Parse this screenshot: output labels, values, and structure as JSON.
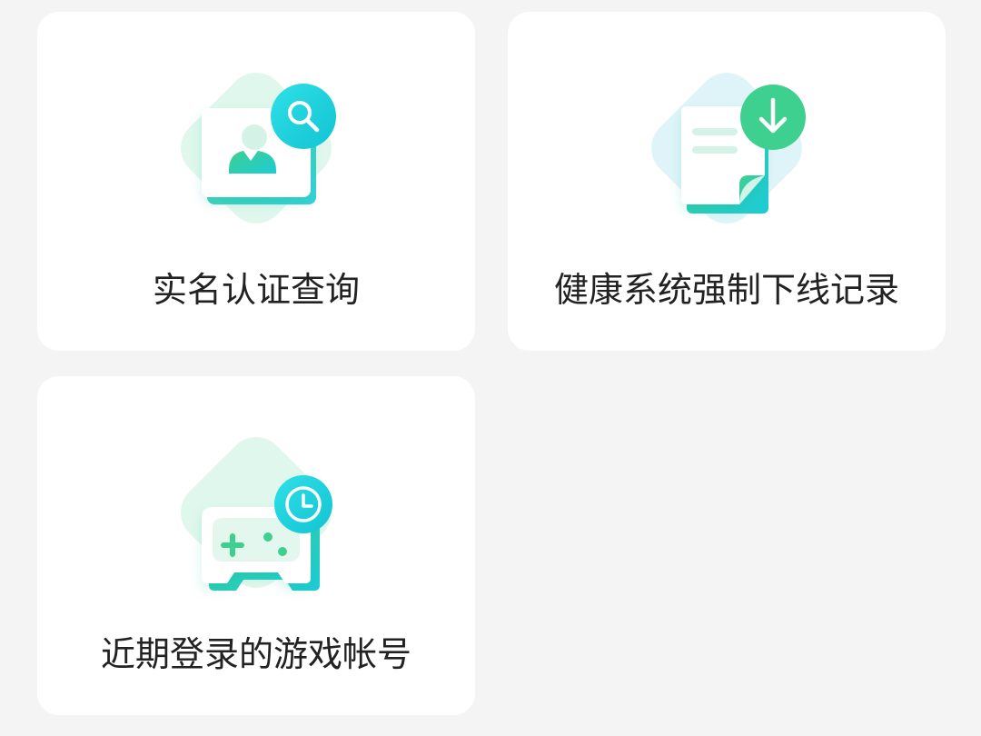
{
  "cards": [
    {
      "label": "实名认证查询",
      "icon": "id-card-search-icon",
      "accent": "#22d3c5"
    },
    {
      "label": "健康系统强制下线记录",
      "icon": "document-download-icon",
      "accent": "#3ed08e"
    },
    {
      "label": "近期登录的游戏帐号",
      "icon": "gamepad-clock-icon",
      "accent": "#22cfe0"
    }
  ],
  "colors": {
    "background": "#f4f4f4",
    "card": "#ffffff",
    "diamond_green": "#dff7ec",
    "diamond_blue": "#dff4f8",
    "text": "#222222"
  }
}
